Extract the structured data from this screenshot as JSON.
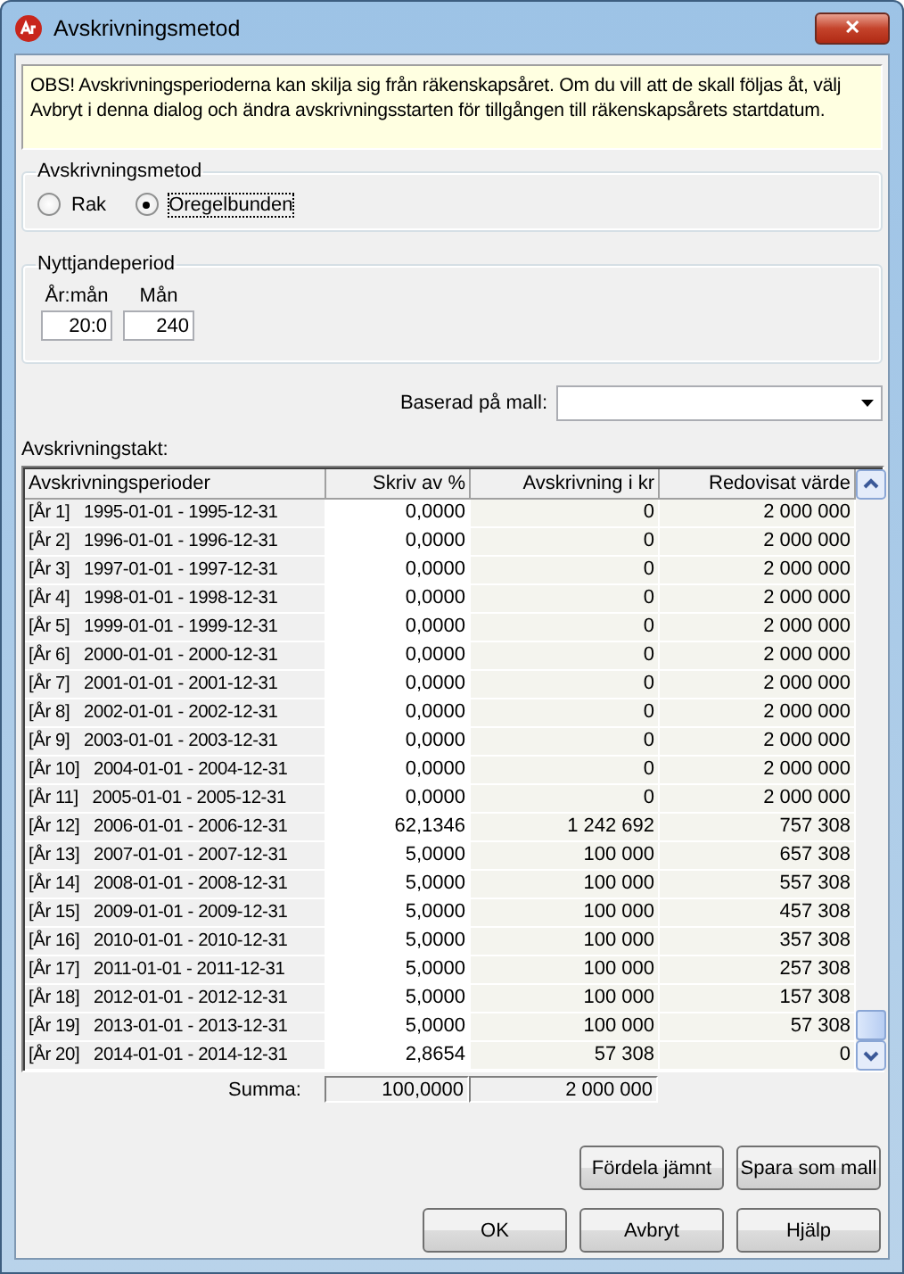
{
  "window": {
    "title": "Avskrivningsmetod",
    "close": "✕"
  },
  "notice": "OBS! Avskrivningsperioderna kan skilja sig från räkenskapsåret. Om du vill att de skall följas åt, välj Avbryt i denna dialog och ändra avskrivningsstarten för tillgången till räkenskapsårets startdatum.",
  "method_group": {
    "title": "Avskrivningsmetod",
    "options": [
      {
        "label": "Rak",
        "selected": false,
        "focused": false
      },
      {
        "label": "Oregelbunden",
        "selected": true,
        "focused": true
      }
    ]
  },
  "period_group": {
    "title": "Nyttjandeperiod",
    "fields": [
      {
        "label": "År:mån",
        "value": "20:0"
      },
      {
        "label": "Mån",
        "value": "240"
      }
    ]
  },
  "template": {
    "label": "Baserad på mall:"
  },
  "table": {
    "label": "Avskrivningstakt:",
    "columns": [
      {
        "label": "Avskrivningsperioder",
        "editable": false
      },
      {
        "label": "Skriv av %",
        "editable": true
      },
      {
        "label": "Avskrivning i kr",
        "editable": false
      },
      {
        "label": "Redovisat värde",
        "editable": false
      }
    ],
    "rows": [
      [
        "[År 1]   1995-01-01 - 1995-12-31",
        "0,0000",
        "0",
        "2 000 000"
      ],
      [
        "[År 2]   1996-01-01 - 1996-12-31",
        "0,0000",
        "0",
        "2 000 000"
      ],
      [
        "[År 3]   1997-01-01 - 1997-12-31",
        "0,0000",
        "0",
        "2 000 000"
      ],
      [
        "[År 4]   1998-01-01 - 1998-12-31",
        "0,0000",
        "0",
        "2 000 000"
      ],
      [
        "[År 5]   1999-01-01 - 1999-12-31",
        "0,0000",
        "0",
        "2 000 000"
      ],
      [
        "[År 6]   2000-01-01 - 2000-12-31",
        "0,0000",
        "0",
        "2 000 000"
      ],
      [
        "[År 7]   2001-01-01 - 2001-12-31",
        "0,0000",
        "0",
        "2 000 000"
      ],
      [
        "[År 8]   2002-01-01 - 2002-12-31",
        "0,0000",
        "0",
        "2 000 000"
      ],
      [
        "[År 9]   2003-01-01 - 2003-12-31",
        "0,0000",
        "0",
        "2 000 000"
      ],
      [
        "[År 10]   2004-01-01 - 2004-12-31",
        "0,0000",
        "0",
        "2 000 000"
      ],
      [
        "[År 11]   2005-01-01 - 2005-12-31",
        "0,0000",
        "0",
        "2 000 000"
      ],
      [
        "[År 12]   2006-01-01 - 2006-12-31",
        "62,1346",
        "1 242 692",
        "757 308"
      ],
      [
        "[År 13]   2007-01-01 - 2007-12-31",
        "5,0000",
        "100 000",
        "657 308"
      ],
      [
        "[År 14]   2008-01-01 - 2008-12-31",
        "5,0000",
        "100 000",
        "557 308"
      ],
      [
        "[År 15]   2009-01-01 - 2009-12-31",
        "5,0000",
        "100 000",
        "457 308"
      ],
      [
        "[År 16]   2010-01-01 - 2010-12-31",
        "5,0000",
        "100 000",
        "357 308"
      ],
      [
        "[År 17]   2011-01-01 - 2011-12-31",
        "5,0000",
        "100 000",
        "257 308"
      ],
      [
        "[År 18]   2012-01-01 - 2012-12-31",
        "5,0000",
        "100 000",
        "157 308"
      ],
      [
        "[År 19]   2013-01-01 - 2013-12-31",
        "5,0000",
        "100 000",
        "57 308"
      ],
      [
        "[År 20]   2014-01-01 - 2014-12-31",
        "2,8654",
        "57 308",
        "0"
      ]
    ],
    "sum_label": "Summa:",
    "sums": [
      "100,0000",
      "2 000 000"
    ]
  },
  "action_buttons": [
    "Fördela jämnt",
    "Spara som mall"
  ],
  "dialog_buttons": [
    "OK",
    "Avbryt",
    "Hjälp"
  ]
}
